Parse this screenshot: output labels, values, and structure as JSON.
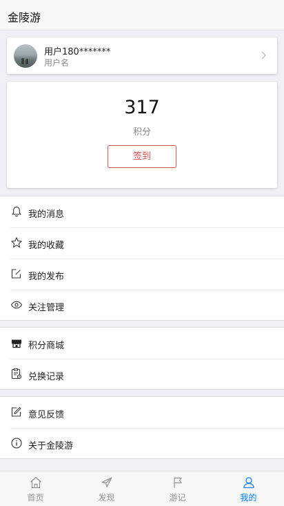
{
  "header": {
    "title": "金陵游"
  },
  "user": {
    "name": "用户180*******",
    "subtitle": "用户名"
  },
  "points": {
    "value": "317",
    "label": "积分",
    "sign_in_label": "签到"
  },
  "menu_group_1": [
    {
      "label": "我的消息",
      "icon": "bell-icon"
    },
    {
      "label": "我的收藏",
      "icon": "star-icon"
    },
    {
      "label": "我的发布",
      "icon": "edit-icon"
    },
    {
      "label": "关注管理",
      "icon": "eye-icon"
    }
  ],
  "menu_group_2": [
    {
      "label": "积分商城",
      "icon": "shop-icon"
    },
    {
      "label": "兑换记录",
      "icon": "record-icon"
    }
  ],
  "menu_group_3": [
    {
      "label": "意见反馈",
      "icon": "feedback-icon"
    },
    {
      "label": "关于金陵游",
      "icon": "info-icon"
    }
  ],
  "tabbar": {
    "tabs": [
      {
        "label": "首页",
        "icon": "home-icon"
      },
      {
        "label": "发现",
        "icon": "paper-plane-icon"
      },
      {
        "label": "游记",
        "icon": "flag-icon"
      },
      {
        "label": "我的",
        "icon": "person-icon"
      }
    ],
    "active_index": 3,
    "active_color": "#007aff",
    "inactive_color": "#929292"
  },
  "colors": {
    "accent_red": "#d0514d",
    "background": "#efeff4"
  }
}
